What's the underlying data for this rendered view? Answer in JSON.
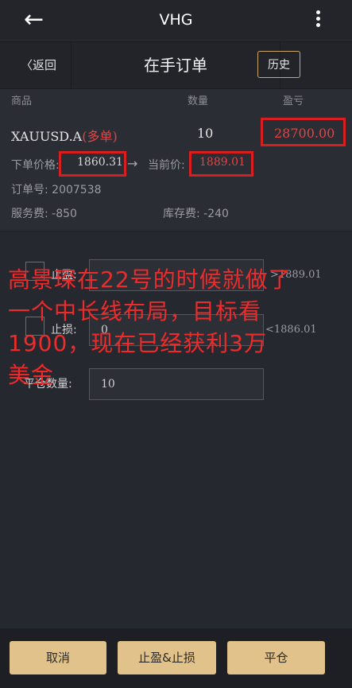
{
  "topbar": {
    "title": "VHG",
    "back_icon": "←"
  },
  "subheader": {
    "back_label": "〈返回",
    "title": "在手订单",
    "history_label": "历史"
  },
  "columns": {
    "product": "商品",
    "quantity": "数量",
    "pnl": "盈亏"
  },
  "order": {
    "symbol": "XAUUSD.A",
    "direction": "(多单)",
    "quantity": "10",
    "pnl": "28700.00",
    "open_price_label": "下单价格:",
    "open_price": "1860.31",
    "arrow": "→",
    "current_price_label": "当前价:",
    "current_price": "1889.01",
    "order_no_label": "订单号:",
    "order_no": "2007538",
    "fee_label": "服务费:",
    "fee": "-850",
    "swap_label": "库存费:",
    "swap": "-240"
  },
  "form": {
    "take_profit_label": "止盈:",
    "take_profit_range": ">1889.01",
    "stop_loss_label": "止损:",
    "stop_loss_value": "0",
    "stop_loss_range": "<1886.01",
    "close_qty_label": "平仓数量:",
    "close_qty_value": "10"
  },
  "overlay": {
    "line1": "高景琛在22号的时候就做了",
    "line2": "一个中长线布局，目标看",
    "line3": "1900，现在已经获利3万",
    "line4": "美金"
  },
  "buttons": {
    "cancel": "取消",
    "tp_sl": "止盈&止损",
    "close": "平仓"
  },
  "colors": {
    "accent": "#e1c28a",
    "loss_red": "#e04545",
    "highlight_red": "#d81f1f",
    "background": "#26282f"
  }
}
